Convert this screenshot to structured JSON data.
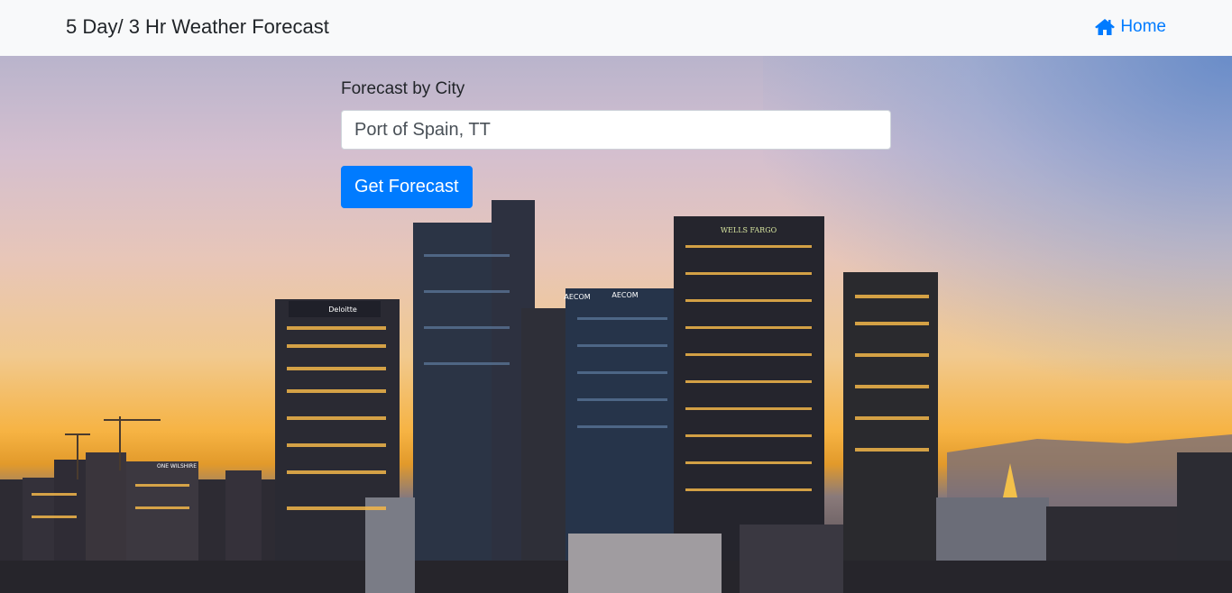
{
  "navbar": {
    "brand": "5 Day/ 3 Hr Weather Forecast",
    "home_label": "Home",
    "home_icon": "home-icon"
  },
  "form": {
    "label": "Forecast by City",
    "city_value": "Port of Spain, TT",
    "button_label": "Get Forecast"
  },
  "background": {
    "description_icon": "city-skyline-photo",
    "signs": {
      "deloitte": "Deloitte",
      "aecom_1": "AECOM",
      "aecom_2": "AECOM",
      "wells_fargo": "WELLS FARGO",
      "one_wilshire": "ONE WILSHIRE"
    }
  },
  "colors": {
    "primary": "#007bff",
    "navbar_bg": "#f8f9fa",
    "text": "#212529"
  }
}
